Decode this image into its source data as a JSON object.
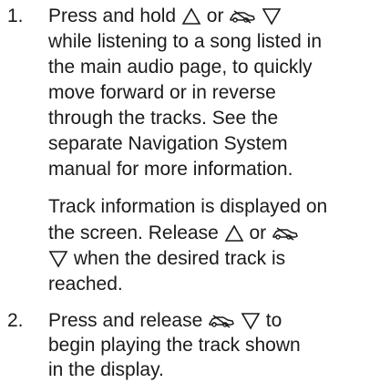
{
  "document": {
    "steps": [
      {
        "number": "1.",
        "lines": [
          {
            "before": "Press and hold ",
            "mid": " or ",
            "after": ""
          },
          {
            "text": "while listening to a song listed in"
          },
          {
            "text": "the main audio page, to quickly"
          },
          {
            "text": "move forward or in reverse"
          },
          {
            "text": "through the tracks. See the"
          },
          {
            "text": "separate Navigation System"
          },
          {
            "text": "manual for more information."
          }
        ],
        "continuation": {
          "line1": "Track information is displayed on",
          "line2_before": "the screen. Release ",
          "line2_mid": " or ",
          "line3_after": " when the desired track is",
          "line4": "reached."
        }
      },
      {
        "number": "2.",
        "line1_before": "Press and release ",
        "line1_after": " to",
        "line2": "begin playing the track shown",
        "line3": "in the display."
      }
    ],
    "icons": {
      "up": "triangle-up-icon",
      "down": "triangle-down-icon",
      "car": "car-icon"
    },
    "text_color": "#1a1a1a"
  }
}
